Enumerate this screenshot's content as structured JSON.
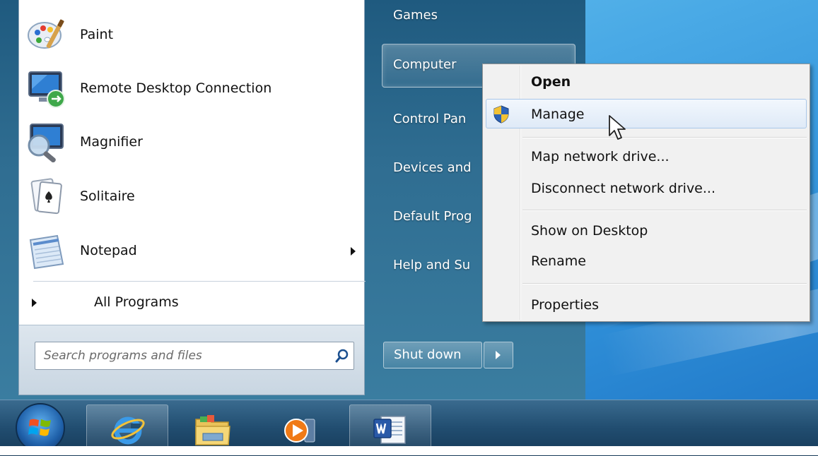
{
  "start_menu": {
    "programs": [
      {
        "label": "Paint",
        "icon": "paint-icon"
      },
      {
        "label": "Remote Desktop Connection",
        "icon": "remote-desktop-icon"
      },
      {
        "label": "Magnifier",
        "icon": "magnifier-icon"
      },
      {
        "label": "Solitaire",
        "icon": "solitaire-icon"
      },
      {
        "label": "Notepad",
        "icon": "notepad-icon",
        "has_submenu": true
      }
    ],
    "all_programs_label": "All Programs",
    "search": {
      "placeholder": "Search programs and files",
      "icon": "search-icon"
    },
    "right_items": [
      {
        "label": "Games"
      },
      {
        "label": "Computer"
      },
      {
        "label": "Control Pan"
      },
      {
        "label": "Devices and"
      },
      {
        "label": "Default Prog"
      },
      {
        "label": "Help and Su"
      }
    ],
    "shutdown_label": "Shut down"
  },
  "context_menu": {
    "items": [
      {
        "label": "Open",
        "bold": true
      },
      {
        "label": "Manage",
        "icon": "uac-shield-icon",
        "hovered": true
      },
      {
        "label": "Map network drive..."
      },
      {
        "label": "Disconnect network drive..."
      },
      {
        "label": "Show on Desktop"
      },
      {
        "label": "Rename"
      },
      {
        "label": "Properties"
      }
    ]
  },
  "taskbar": {
    "items": [
      {
        "icon": "start-orb-icon"
      },
      {
        "icon": "internet-explorer-icon",
        "active": true
      },
      {
        "icon": "windows-explorer-icon"
      },
      {
        "icon": "media-player-icon"
      },
      {
        "icon": "word-icon",
        "active": true
      }
    ]
  },
  "colors": {
    "start_menu_bg": "#2f6d91",
    "taskbar_bg": "#214d70",
    "context_hover": "#dfeaf7",
    "desktop": "#3a9fe0"
  }
}
